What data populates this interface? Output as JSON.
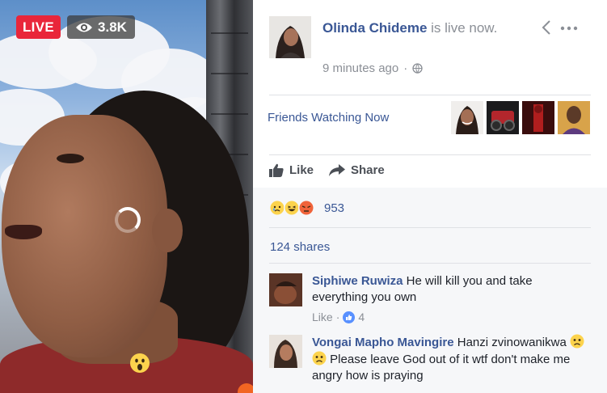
{
  "video": {
    "live_label": "LIVE",
    "viewer_count": "3.8K",
    "eye_icon": "eye-icon"
  },
  "header": {
    "host_name": "Olinda Chideme",
    "host_status": " is live now.",
    "time_ago": "9 minutes ago",
    "separator": "·",
    "privacy_icon": "globe-icon"
  },
  "friends": {
    "label": "Friends Watching Now",
    "count": 4
  },
  "actions": {
    "like": "Like",
    "share": "Share"
  },
  "stats": {
    "reaction_icons": [
      "sad-reaction-icon",
      "haha-reaction-icon",
      "angry-reaction-icon"
    ],
    "reaction_count": "953",
    "shares": "124 shares"
  },
  "comments": [
    {
      "author": "Siphiwe Ruwiza",
      "text": " He will kill you and take everything you own",
      "like_label": "Like",
      "separator": "·",
      "likes": "4"
    },
    {
      "author": "Vongai Mapho Mavingire",
      "text_before": " Hanzi zvinowanikwa ",
      "text_after": " Please leave God out of it wtf don't make me angry how is praying"
    }
  ],
  "colors": {
    "live_red": "#e9263a",
    "link_blue": "#3a5795",
    "meta_gray": "#8b8f96",
    "panel_gray": "#f6f7f9"
  }
}
